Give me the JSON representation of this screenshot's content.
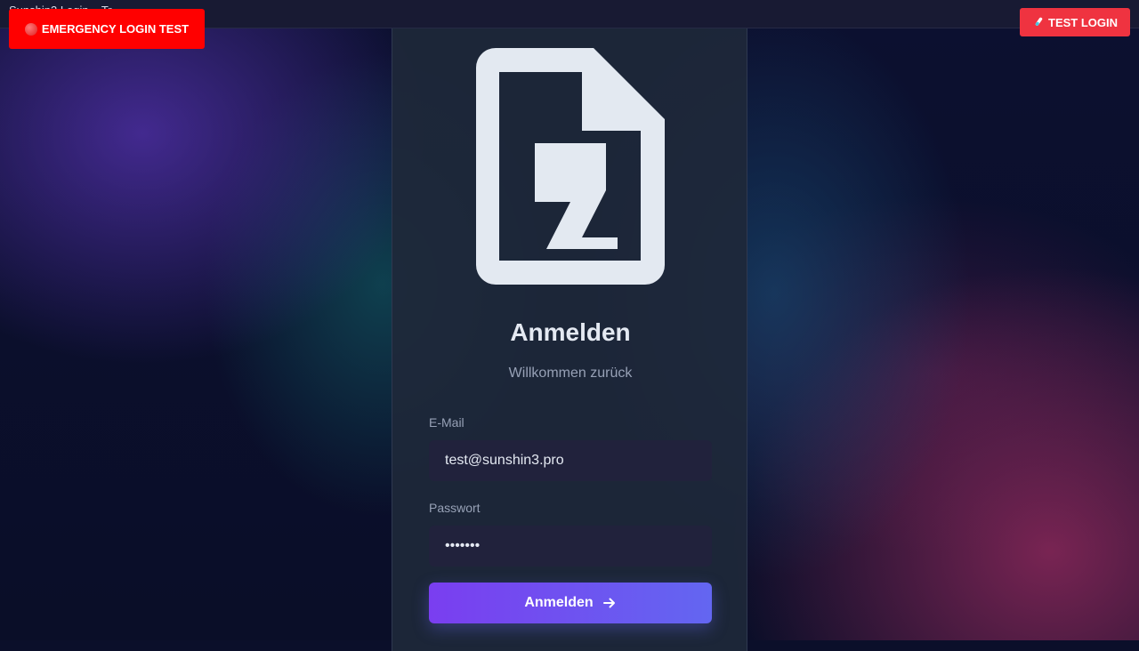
{
  "topbar": {
    "title": "Sunshin3 Login – Tr"
  },
  "emergency_button": {
    "label": "EMERGENCY LOGIN TEST",
    "icon": "red-circle-icon",
    "color": "#ff0000"
  },
  "test_button": {
    "label": "TEST LOGIN",
    "icon": "test-tube-icon",
    "color": "#ef3340"
  },
  "login": {
    "logo_icon": "document-logo-icon",
    "title": "Anmelden",
    "subtitle": "Willkommen zurück",
    "email": {
      "label": "E-Mail",
      "value": "test@sunshin3.pro"
    },
    "password": {
      "label": "Passwort",
      "value": "•••••••"
    },
    "submit": {
      "label": "Anmelden",
      "icon": "arrow-right-icon"
    }
  },
  "colors": {
    "accent_start": "#7a3ef0",
    "accent_end": "#6366f1",
    "card_bg": "#1e283a",
    "input_bg": "#21223c"
  }
}
